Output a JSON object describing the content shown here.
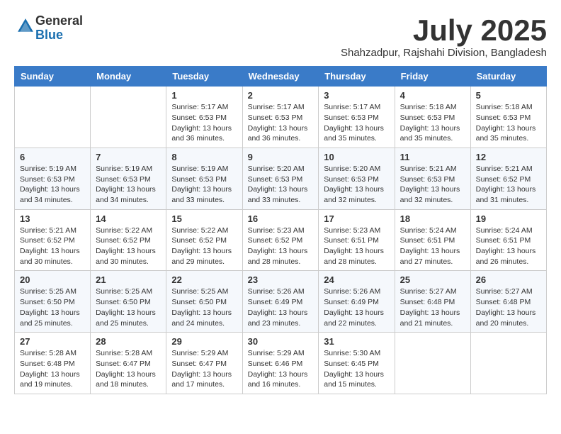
{
  "header": {
    "logo_general": "General",
    "logo_blue": "Blue",
    "month_title": "July 2025",
    "location": "Shahzadpur, Rajshahi Division, Bangladesh"
  },
  "weekdays": [
    "Sunday",
    "Monday",
    "Tuesday",
    "Wednesday",
    "Thursday",
    "Friday",
    "Saturday"
  ],
  "weeks": [
    [
      {
        "day": "",
        "sunrise": "",
        "sunset": "",
        "daylight": ""
      },
      {
        "day": "",
        "sunrise": "",
        "sunset": "",
        "daylight": ""
      },
      {
        "day": "1",
        "sunrise": "Sunrise: 5:17 AM",
        "sunset": "Sunset: 6:53 PM",
        "daylight": "Daylight: 13 hours and 36 minutes."
      },
      {
        "day": "2",
        "sunrise": "Sunrise: 5:17 AM",
        "sunset": "Sunset: 6:53 PM",
        "daylight": "Daylight: 13 hours and 36 minutes."
      },
      {
        "day": "3",
        "sunrise": "Sunrise: 5:17 AM",
        "sunset": "Sunset: 6:53 PM",
        "daylight": "Daylight: 13 hours and 35 minutes."
      },
      {
        "day": "4",
        "sunrise": "Sunrise: 5:18 AM",
        "sunset": "Sunset: 6:53 PM",
        "daylight": "Daylight: 13 hours and 35 minutes."
      },
      {
        "day": "5",
        "sunrise": "Sunrise: 5:18 AM",
        "sunset": "Sunset: 6:53 PM",
        "daylight": "Daylight: 13 hours and 35 minutes."
      }
    ],
    [
      {
        "day": "6",
        "sunrise": "Sunrise: 5:19 AM",
        "sunset": "Sunset: 6:53 PM",
        "daylight": "Daylight: 13 hours and 34 minutes."
      },
      {
        "day": "7",
        "sunrise": "Sunrise: 5:19 AM",
        "sunset": "Sunset: 6:53 PM",
        "daylight": "Daylight: 13 hours and 34 minutes."
      },
      {
        "day": "8",
        "sunrise": "Sunrise: 5:19 AM",
        "sunset": "Sunset: 6:53 PM",
        "daylight": "Daylight: 13 hours and 33 minutes."
      },
      {
        "day": "9",
        "sunrise": "Sunrise: 5:20 AM",
        "sunset": "Sunset: 6:53 PM",
        "daylight": "Daylight: 13 hours and 33 minutes."
      },
      {
        "day": "10",
        "sunrise": "Sunrise: 5:20 AM",
        "sunset": "Sunset: 6:53 PM",
        "daylight": "Daylight: 13 hours and 32 minutes."
      },
      {
        "day": "11",
        "sunrise": "Sunrise: 5:21 AM",
        "sunset": "Sunset: 6:53 PM",
        "daylight": "Daylight: 13 hours and 32 minutes."
      },
      {
        "day": "12",
        "sunrise": "Sunrise: 5:21 AM",
        "sunset": "Sunset: 6:52 PM",
        "daylight": "Daylight: 13 hours and 31 minutes."
      }
    ],
    [
      {
        "day": "13",
        "sunrise": "Sunrise: 5:21 AM",
        "sunset": "Sunset: 6:52 PM",
        "daylight": "Daylight: 13 hours and 30 minutes."
      },
      {
        "day": "14",
        "sunrise": "Sunrise: 5:22 AM",
        "sunset": "Sunset: 6:52 PM",
        "daylight": "Daylight: 13 hours and 30 minutes."
      },
      {
        "day": "15",
        "sunrise": "Sunrise: 5:22 AM",
        "sunset": "Sunset: 6:52 PM",
        "daylight": "Daylight: 13 hours and 29 minutes."
      },
      {
        "day": "16",
        "sunrise": "Sunrise: 5:23 AM",
        "sunset": "Sunset: 6:52 PM",
        "daylight": "Daylight: 13 hours and 28 minutes."
      },
      {
        "day": "17",
        "sunrise": "Sunrise: 5:23 AM",
        "sunset": "Sunset: 6:51 PM",
        "daylight": "Daylight: 13 hours and 28 minutes."
      },
      {
        "day": "18",
        "sunrise": "Sunrise: 5:24 AM",
        "sunset": "Sunset: 6:51 PM",
        "daylight": "Daylight: 13 hours and 27 minutes."
      },
      {
        "day": "19",
        "sunrise": "Sunrise: 5:24 AM",
        "sunset": "Sunset: 6:51 PM",
        "daylight": "Daylight: 13 hours and 26 minutes."
      }
    ],
    [
      {
        "day": "20",
        "sunrise": "Sunrise: 5:25 AM",
        "sunset": "Sunset: 6:50 PM",
        "daylight": "Daylight: 13 hours and 25 minutes."
      },
      {
        "day": "21",
        "sunrise": "Sunrise: 5:25 AM",
        "sunset": "Sunset: 6:50 PM",
        "daylight": "Daylight: 13 hours and 25 minutes."
      },
      {
        "day": "22",
        "sunrise": "Sunrise: 5:25 AM",
        "sunset": "Sunset: 6:50 PM",
        "daylight": "Daylight: 13 hours and 24 minutes."
      },
      {
        "day": "23",
        "sunrise": "Sunrise: 5:26 AM",
        "sunset": "Sunset: 6:49 PM",
        "daylight": "Daylight: 13 hours and 23 minutes."
      },
      {
        "day": "24",
        "sunrise": "Sunrise: 5:26 AM",
        "sunset": "Sunset: 6:49 PM",
        "daylight": "Daylight: 13 hours and 22 minutes."
      },
      {
        "day": "25",
        "sunrise": "Sunrise: 5:27 AM",
        "sunset": "Sunset: 6:48 PM",
        "daylight": "Daylight: 13 hours and 21 minutes."
      },
      {
        "day": "26",
        "sunrise": "Sunrise: 5:27 AM",
        "sunset": "Sunset: 6:48 PM",
        "daylight": "Daylight: 13 hours and 20 minutes."
      }
    ],
    [
      {
        "day": "27",
        "sunrise": "Sunrise: 5:28 AM",
        "sunset": "Sunset: 6:48 PM",
        "daylight": "Daylight: 13 hours and 19 minutes."
      },
      {
        "day": "28",
        "sunrise": "Sunrise: 5:28 AM",
        "sunset": "Sunset: 6:47 PM",
        "daylight": "Daylight: 13 hours and 18 minutes."
      },
      {
        "day": "29",
        "sunrise": "Sunrise: 5:29 AM",
        "sunset": "Sunset: 6:47 PM",
        "daylight": "Daylight: 13 hours and 17 minutes."
      },
      {
        "day": "30",
        "sunrise": "Sunrise: 5:29 AM",
        "sunset": "Sunset: 6:46 PM",
        "daylight": "Daylight: 13 hours and 16 minutes."
      },
      {
        "day": "31",
        "sunrise": "Sunrise: 5:30 AM",
        "sunset": "Sunset: 6:45 PM",
        "daylight": "Daylight: 13 hours and 15 minutes."
      },
      {
        "day": "",
        "sunrise": "",
        "sunset": "",
        "daylight": ""
      },
      {
        "day": "",
        "sunrise": "",
        "sunset": "",
        "daylight": ""
      }
    ]
  ]
}
